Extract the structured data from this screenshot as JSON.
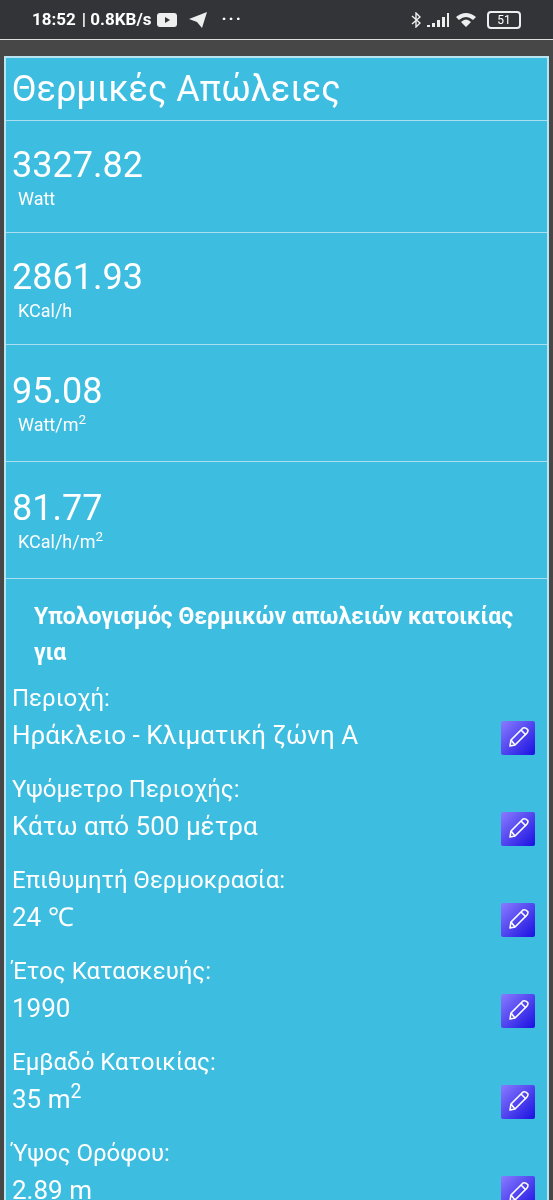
{
  "status_bar": {
    "time": "18:52",
    "speed": "| 0.8KB/s",
    "more": "···",
    "battery": "51"
  },
  "title": "Θερμικές Απώλειες",
  "results": [
    {
      "value": "3327.82",
      "unit": "Watt"
    },
    {
      "value": "2861.93",
      "unit": "KCal/h"
    },
    {
      "value": "95.08",
      "unit": "Watt/m$^{2}$"
    },
    {
      "value": "81.77",
      "unit": "KCal/h/m$^{2}$"
    }
  ],
  "heading": "Υπολογισμός Θερμικών απωλειών κατοικίας για",
  "parameters": [
    {
      "label": "Περιοχή:",
      "value": "Ηράκλειο - Κλιματική ζώνη Α"
    },
    {
      "label": "Υψόμετρο Περιοχής:",
      "value": "Κάτω από 500 μέτρα"
    },
    {
      "label": "Επιθυμητή Θερμοκρασία:",
      "value": "24 ℃"
    },
    {
      "label": "Έτος Κατασκευής:",
      "value": "1990"
    },
    {
      "label": "Εμβαδό Κατοικίας:",
      "value": "35 m$^{2}$"
    },
    {
      "label": "Ύψος Ορόφου:",
      "value": "2.89 m"
    }
  ]
}
